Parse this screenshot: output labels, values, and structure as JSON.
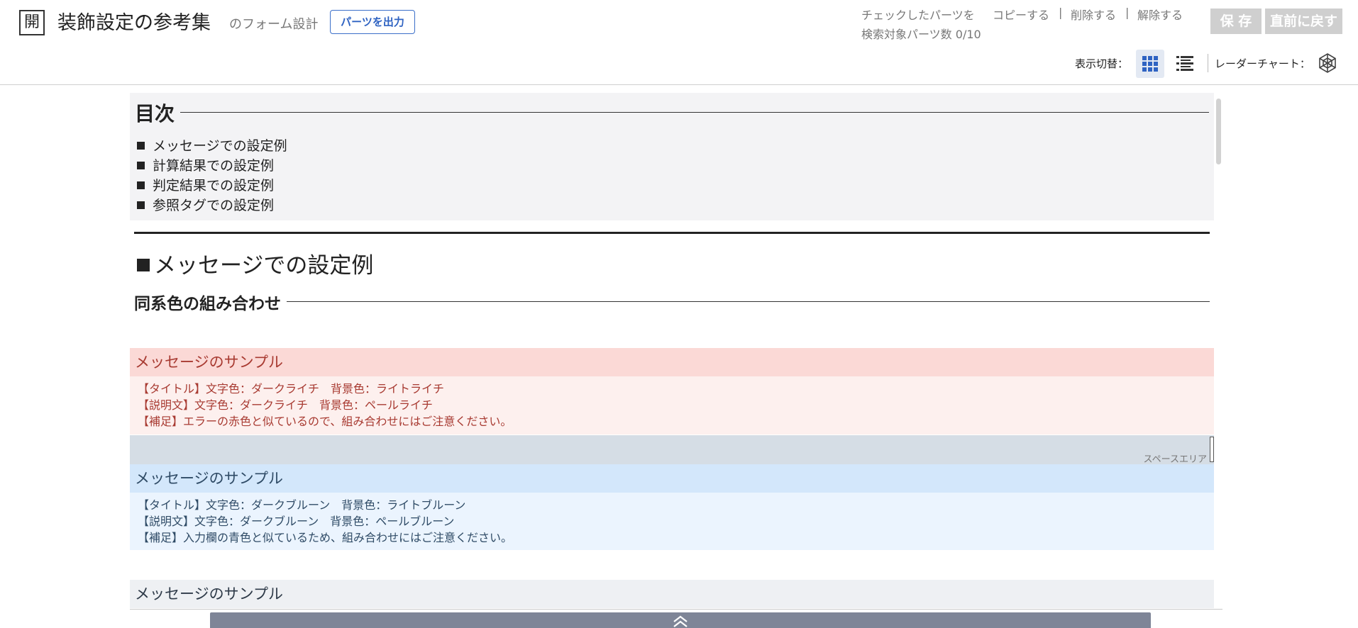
{
  "header": {
    "open_icon_char": "開",
    "title": "装飾設定の参考集",
    "subtitle": "のフォーム設計",
    "export_button": "パーツを出力",
    "checked_parts_label": "チェックしたパーツを",
    "actions": [
      "コピーする",
      "削除する",
      "解除する"
    ],
    "separator": "|",
    "search_count": "検索対象パーツ数 0/10",
    "save_button": "保 存",
    "undo_button": "直前に戻す",
    "view_toggle_label": "表示切替：",
    "radar_chart_label": "レーダーチャート："
  },
  "toc": {
    "heading": "目次",
    "items": [
      "メッセージでの設定例",
      "計算結果での設定例",
      "判定結果での設定例",
      "参照タグでの設定例"
    ]
  },
  "section": {
    "title": "メッセージでの設定例",
    "subheading": "同系色の組み合わせ"
  },
  "messages": [
    {
      "title": "メッセージのサンプル",
      "lines": [
        "【タイトル】文字色：ダークライチ　背景色：ライトライチ",
        "【説明文】文字色：ダークライチ　背景色：ペールライチ",
        "【補足】エラーの赤色と似ているので、組み合わせにはご注意ください。"
      ]
    },
    {
      "title": "メッセージのサンプル",
      "lines": [
        "【タイトル】文字色：ダークブルーン　背景色：ライトブルーン",
        "【説明文】文字色：ダークブルーン　背景色：ペールブルーン",
        "【補足】入力欄の青色と似ているため、組み合わせにはご注意ください。"
      ]
    },
    {
      "title": "メッセージのサンプル"
    }
  ],
  "space_area_label": "スペースエリア",
  "colors": {
    "accent": "#2f63c2",
    "red_title_bg": "#fbd9d6",
    "red_body_bg": "#fdf0ee",
    "red_text": "#a83a31",
    "blue_title_bg": "#d3e7fb",
    "blue_body_bg": "#ebf4fe",
    "blue_text": "#2f4b66"
  },
  "icons": [
    "grid-view-icon",
    "list-view-icon",
    "radar-chart-icon",
    "double-chevron-up-icon"
  ]
}
